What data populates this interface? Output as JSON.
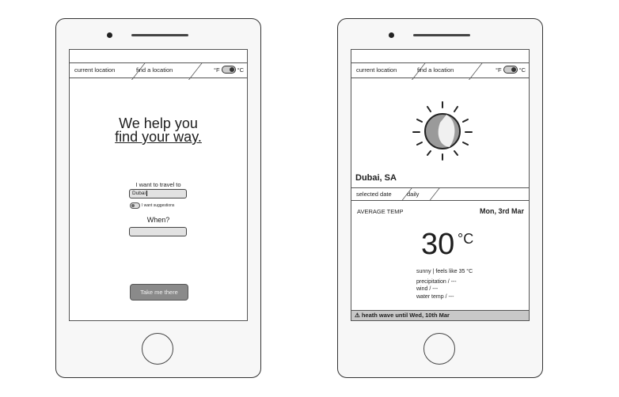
{
  "phones": [
    {
      "tabs": {
        "current_location": "current location",
        "find_location": "find a location"
      },
      "unit_toggle": {
        "f": "°F",
        "c": "°C"
      },
      "hero": {
        "line1": "We help you",
        "line2": "find your way."
      },
      "travel_label": "I want to travel to",
      "destination_value": "Dubai",
      "suggestions_label": "I want suggestions",
      "when_label": "When?",
      "when_value": "",
      "cta_label": "Take me there"
    },
    {
      "tabs": {
        "current_location": "current location",
        "find_location": "find a location"
      },
      "unit_toggle": {
        "f": "°F",
        "c": "°C"
      },
      "city": "Dubai, SA",
      "subtabs": {
        "selected_date": "selected date",
        "daily": "daily"
      },
      "average_temp_label": "AVERAGE TEMP",
      "date": "Mon, 3rd Mar",
      "temperature": "30",
      "temperature_unit": "°C",
      "conditions": "sunny | feels like 35 °C",
      "precipitation": "precipitation / ---",
      "wind": "wind / ---",
      "water_temp": "water temp / ---",
      "alert": "heath wave until Wed, 10th Mar",
      "weather_icon": "sun-icon",
      "alert_icon": "warning-icon"
    }
  ]
}
